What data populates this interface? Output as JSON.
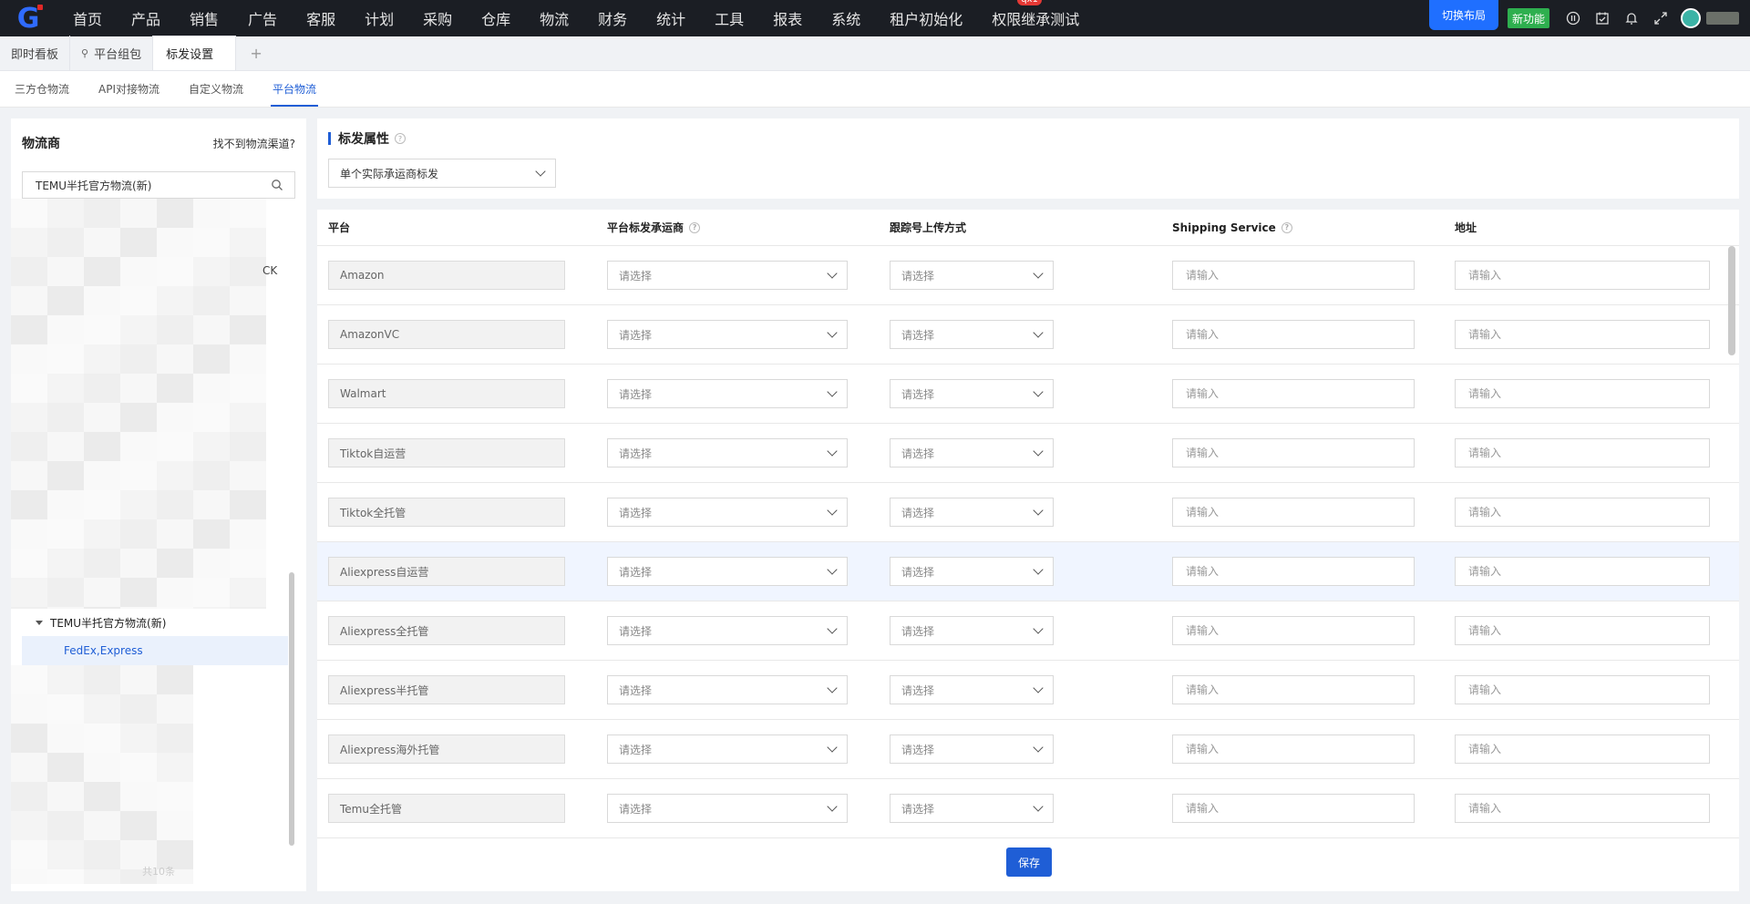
{
  "nav": {
    "items": [
      "首页",
      "产品",
      "销售",
      "广告",
      "客服",
      "计划",
      "采购",
      "仓库",
      "物流",
      "财务",
      "统计",
      "工具",
      "报表",
      "系统",
      "租户初始化",
      "权限继承测试"
    ],
    "badge": "qx1",
    "switch_layout": "切换布局",
    "new_feature": "新功能"
  },
  "page_tabs": {
    "items": [
      "即时看板",
      "平台组包",
      "标发设置"
    ],
    "add": "+"
  },
  "sub_tabs": [
    "三方仓物流",
    "API对接物流",
    "自定义物流",
    "平台物流"
  ],
  "left": {
    "title": "物流商",
    "link": "找不到物流渠道?",
    "search_value": "TEMU半托官方物流(新)",
    "partial_text": "CK",
    "tree_parent": "TEMU半托官方物流(新)",
    "tree_child": "FedEx,Express",
    "footer": "共10条"
  },
  "right": {
    "section_title": "标发属性",
    "mode_select": "单个实际承运商标发",
    "headers": [
      "平台",
      "平台标发承运商",
      "跟踪号上传方式",
      "Shipping Service",
      "地址"
    ],
    "select_placeholder": "请选择",
    "input_placeholder": "请输入",
    "platforms": [
      "Amazon",
      "AmazonVC",
      "Walmart",
      "Tiktok自运营",
      "Tiktok全托管",
      "Aliexpress自运营",
      "Aliexpress全托管",
      "Aliexpress半托管",
      "Aliexpress海外托管",
      "Temu全托管"
    ],
    "highlighted_row": 5,
    "save": "保存"
  },
  "colors": {
    "accent": "#1f5ed6",
    "topbar": "#1b1e24",
    "new_feature": "#2eaf4f",
    "badge": "#e53935"
  }
}
